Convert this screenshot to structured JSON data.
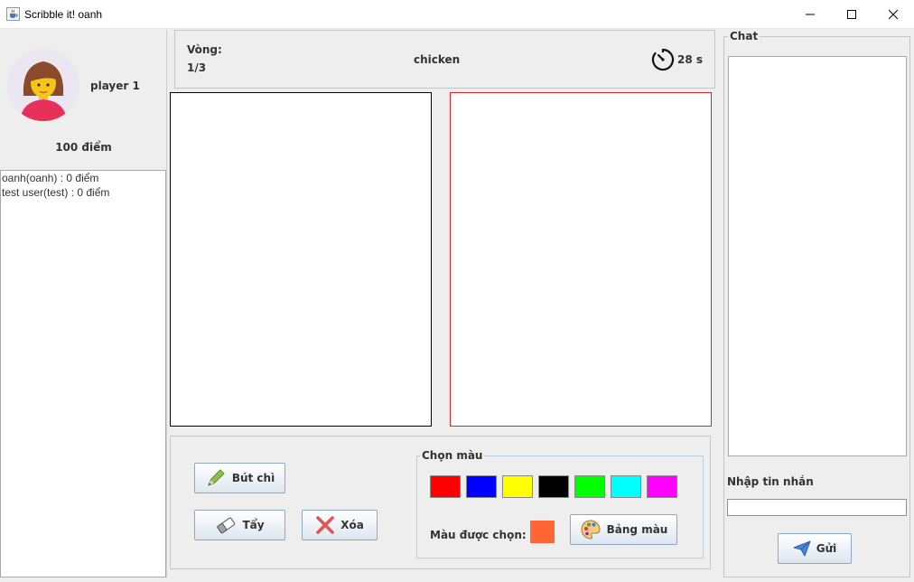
{
  "window": {
    "title": "Scribble it! oanh",
    "icons": {
      "app": "java-cup-icon",
      "minimize": "minimize-icon",
      "maximize": "maximize-icon",
      "close": "close-icon"
    }
  },
  "player": {
    "name": "player 1",
    "score": "100 điểm",
    "avatar_icon": "woman-avatar-icon"
  },
  "scoreboard": {
    "items": [
      "oanh(oanh) : 0 điểm",
      "test user(test) : 0 điểm"
    ]
  },
  "round": {
    "label": "Vòng:",
    "value": "1/3",
    "word": "chicken",
    "timer": "28 s",
    "timer_icon": "stopwatch-icon"
  },
  "canvas": {
    "left_border": "#000000",
    "right_border": "#d62828"
  },
  "tools": {
    "pencil_label": "Bút chì",
    "eraser_label": "Tẩy",
    "clear_label": "Xóa"
  },
  "colors": {
    "group_title": "Chọn màu",
    "swatches": [
      "#ff0000",
      "#0000ff",
      "#ffff00",
      "#000000",
      "#00ff00",
      "#00ffff",
      "#ff00ff"
    ],
    "selected_label": "Màu được chọn:",
    "selected": "#ff6633",
    "palette_label": "Bảng màu"
  },
  "chat": {
    "title": "Chat",
    "input_label": "Nhập tin nhắn",
    "input_value": "",
    "send_label": "Gửi"
  }
}
